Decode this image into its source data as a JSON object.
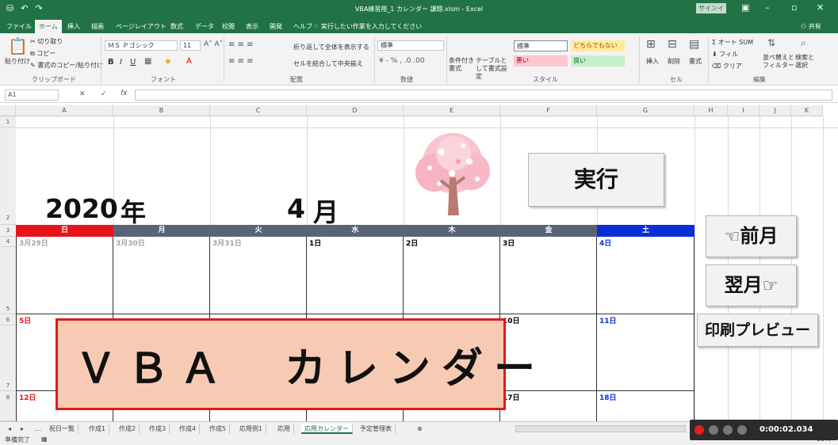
{
  "titlebar": {
    "title": "VBA練習用_1 カレンダー 課題.xlsm - Excel",
    "signin": "サインイン",
    "qat_save": "⛁",
    "qat_undo": "↶",
    "qat_redo": "↷"
  },
  "tabs": {
    "items": [
      "ファイル",
      "ホーム",
      "挿入",
      "描画",
      "ページレイアウト",
      "数式",
      "データ",
      "校閲",
      "表示",
      "開発",
      "ヘルプ"
    ],
    "tellme": "実行したい作業を入力してください",
    "share": "共有"
  },
  "ribbon": {
    "paste": "貼り付け",
    "cut": "切り取り",
    "copy": "コピー",
    "format_painter": "書式のコピー/貼り付け",
    "clipboard": "クリップボード",
    "font_name": "ＭＳ Ｐゴシック",
    "font_size": "11",
    "font_group": "フォント",
    "wrap_text": "折り返して全体を表示する",
    "merge_center": "セルを結合して中央揃え",
    "align_group": "配置",
    "number_format": "標準",
    "number_group": "数値",
    "cond_format": "条件付き書式",
    "table_format": "テーブルとして書式設定",
    "style_normal": "標準",
    "style_neutral": "どちらでもない",
    "style_bad": "悪い",
    "style_good": "良い",
    "style_group": "スタイル",
    "insert": "挿入",
    "delete": "削除",
    "format": "書式",
    "cells_group": "セル",
    "autosum": "オート SUM",
    "fill": "フィル",
    "clear": "クリア",
    "sort_filter": "並べ替えとフィルター",
    "find_select": "検索と選択",
    "edit_group": "編集",
    "bold": "B",
    "italic": "I",
    "underline": "U"
  },
  "formula": {
    "namebox": "A1",
    "fx": "fx"
  },
  "sheet": {
    "columns": [
      "A",
      "B",
      "C",
      "D",
      "E",
      "F",
      "G",
      "H",
      "I",
      "J",
      "K"
    ],
    "rows": [
      "1",
      "2",
      "3",
      "4",
      "5",
      "6",
      "7",
      "8"
    ]
  },
  "calendar": {
    "year": "2020",
    "year_suffix": "年",
    "month": "4",
    "month_suffix": "月",
    "weekdays": [
      "日",
      "月",
      "火",
      "水",
      "木",
      "金",
      "土"
    ],
    "week1": [
      "3月29日",
      "3月30日",
      "3月31日",
      "1日",
      "2日",
      "3日",
      "4日"
    ],
    "week2_visible": [
      "5日",
      "10日",
      "11日"
    ],
    "week3_visible": [
      "12日",
      "17日",
      "18日"
    ],
    "colors": {
      "sunday": "#e8141b",
      "weekday": "#5a6478",
      "saturday": "#0a2fd6",
      "sunday_text": "#e8141b",
      "prev_month_text": "#a6a6a6",
      "saturday_text": "#0a2fd6"
    }
  },
  "buttons": {
    "run": "実行",
    "prev": "前月",
    "next": "翌月",
    "print_preview": "印刷プレビュー"
  },
  "overlay": {
    "text": "ＶＢＡ　カレンダー"
  },
  "sheettabs": [
    "祝日一覧",
    "作成1",
    "作成2",
    "作成3",
    "作成4",
    "作成5",
    "応用例1",
    "応用",
    "応用カレンダー",
    "予定管理表"
  ],
  "active_sheet": "応用カレンダー",
  "status": {
    "ready": "準備完了",
    "zoom": "90%"
  },
  "recorder": {
    "time": "0:00:02.034"
  }
}
